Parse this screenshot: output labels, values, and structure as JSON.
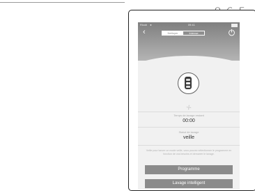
{
  "page_label": "8.6-5",
  "status_bar": {
    "carrier": "Ricoh",
    "signal": "●",
    "time": "09:41"
  },
  "nav": {
    "back_glyph": "‹",
    "segments": [
      {
        "label": "Nettoyer",
        "active": true
      },
      {
        "label": "Intense",
        "active": false
      }
    ],
    "power_icon": "power-icon"
  },
  "robot_icon": "robot-vacuum-icon",
  "fan_icon": "fan-icon",
  "rows": [
    {
      "label": "Temps de lavage restant",
      "value": "00:00"
    },
    {
      "label": "Statut de lavage",
      "value": "veille"
    }
  ],
  "note": "Veille pour lancer un mode veille, vous pouvez sélectionner le programme en fonction de vos besoins et demarrer le lavage.",
  "buttons": {
    "primary": "Programme",
    "secondary": "Lavage intelligent"
  },
  "colors": {
    "header": "#9a9a9a",
    "button": "#8b8b8b",
    "screen_bg": "#f1f1f1"
  }
}
